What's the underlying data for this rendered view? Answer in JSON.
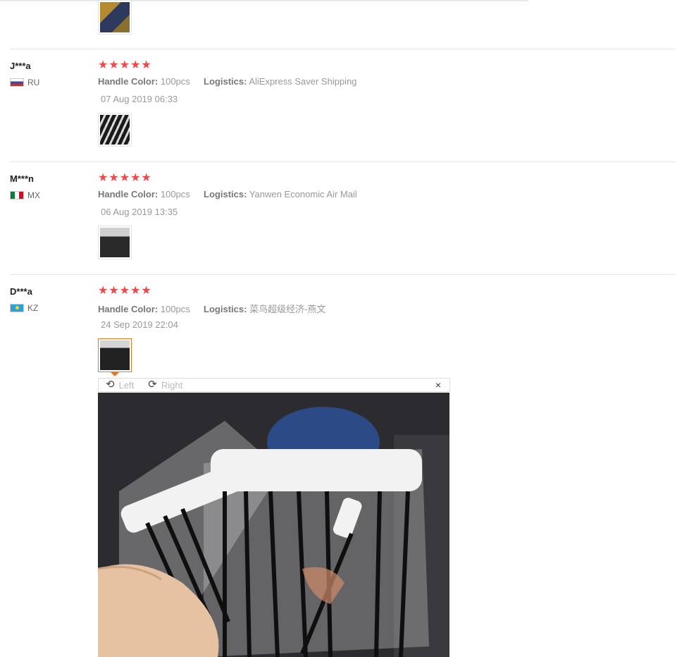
{
  "reviews": [
    {
      "user": "J***a",
      "country": "RU",
      "stars": "★★★★★",
      "color_label": "Handle Color:",
      "color_value": "100pcs",
      "logistics_label": "Logistics:",
      "logistics_value": "AliExpress Saver Shipping",
      "date": "07 Aug 2019 06:33"
    },
    {
      "user": "M***n",
      "country": "MX",
      "stars": "★★★★★",
      "color_label": "Handle Color:",
      "color_value": "100pcs",
      "logistics_label": "Logistics:",
      "logistics_value": "Yanwen Economic Air Mail",
      "date": "06 Aug 2019 13:35"
    },
    {
      "user": "D***a",
      "country": "KZ",
      "stars": "★★★★★",
      "color_label": "Handle Color:",
      "color_value": "100pcs",
      "logistics_label": "Logistics:",
      "logistics_value": "菜鸟超级经济-燕文",
      "date": "24 Sep 2019 22:04"
    }
  ],
  "viewer": {
    "left_label": "Left",
    "right_label": "Right",
    "close_symbol": "×",
    "rotate_left_icon": "⟲",
    "rotate_right_icon": "⟳"
  }
}
